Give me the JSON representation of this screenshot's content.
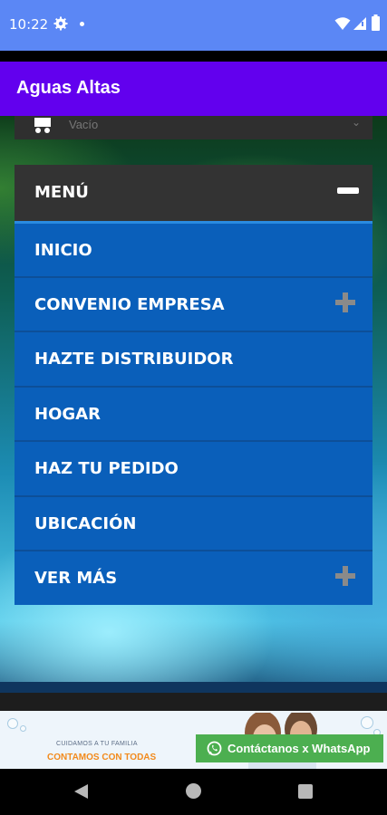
{
  "status_bar": {
    "time": "10:22",
    "icons": [
      "gear-icon",
      "dot-icon",
      "wifi-icon",
      "signal-icon",
      "battery-icon"
    ]
  },
  "app": {
    "title": "Aguas Altas",
    "colors": {
      "status_bar": "#5b87f5",
      "app_bar": "#6200ee",
      "menu_item": "#0a5fba",
      "menu_header": "#333333"
    }
  },
  "cart": {
    "text": "Vacío",
    "icon": "cart-icon"
  },
  "menu": {
    "title": "MENÚ",
    "collapse_icon": "minus-icon",
    "items": [
      {
        "label": "INICIO",
        "expandable": false
      },
      {
        "label": "CONVENIO EMPRESA",
        "expandable": true
      },
      {
        "label": "HAZTE DISTRIBUIDOR",
        "expandable": false
      },
      {
        "label": "HOGAR",
        "expandable": false
      },
      {
        "label": "HAZ TU PEDIDO",
        "expandable": false
      },
      {
        "label": "UBICACIÓN",
        "expandable": false
      },
      {
        "label": "VER MÁS",
        "expandable": true
      }
    ]
  },
  "ad": {
    "line1": "CUIDAMOS A TU FAMILIA",
    "line2": "CONTAMOS CON TODAS"
  },
  "whatsapp": {
    "label": "Contáctanos x WhatsApp",
    "color": "#4caf50"
  },
  "nav_bar": {
    "icons": [
      "back-icon",
      "home-icon",
      "recent-apps-icon"
    ]
  }
}
